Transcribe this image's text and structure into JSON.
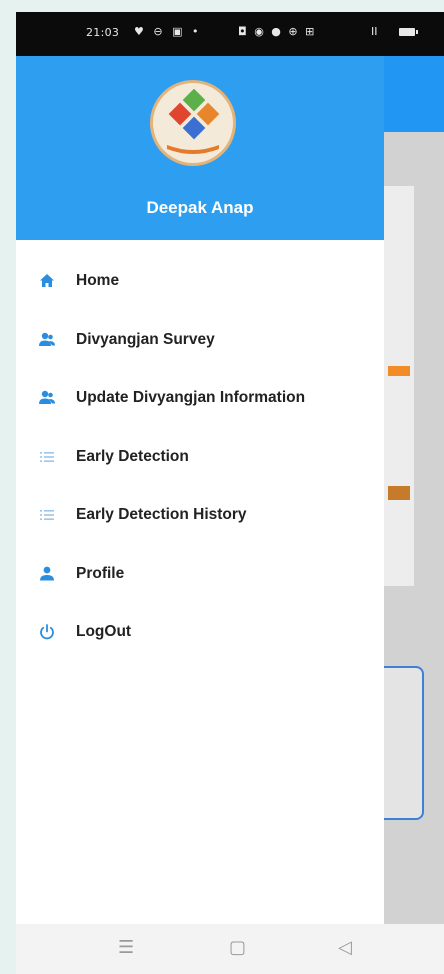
{
  "status_bar": {
    "time": "21:03",
    "left_icons": "♥ ⊖ ▣ •",
    "right_icons": "◘ ◉ ● ⊕ ⊞",
    "signal": "ⵏⵏ"
  },
  "drawer": {
    "user_name": "Deepak Anap",
    "avatar_icon": "accessibility-logo-icon",
    "accent_color": "#2e9ff0",
    "icon_color": "#2a8ee0",
    "menu": [
      {
        "label": "Home",
        "icon": "home-icon"
      },
      {
        "label": "Divyangjan Survey",
        "icon": "people-icon"
      },
      {
        "label": "Update Divyangjan Information",
        "icon": "people-icon"
      },
      {
        "label": "Early Detection",
        "icon": "list-icon"
      },
      {
        "label": "Early Detection History",
        "icon": "list-icon"
      },
      {
        "label": "Profile",
        "icon": "person-icon"
      },
      {
        "label": "LogOut",
        "icon": "power-icon"
      }
    ]
  },
  "nav_bar": {
    "recent": "☰",
    "home": "▢",
    "back": "◁"
  }
}
